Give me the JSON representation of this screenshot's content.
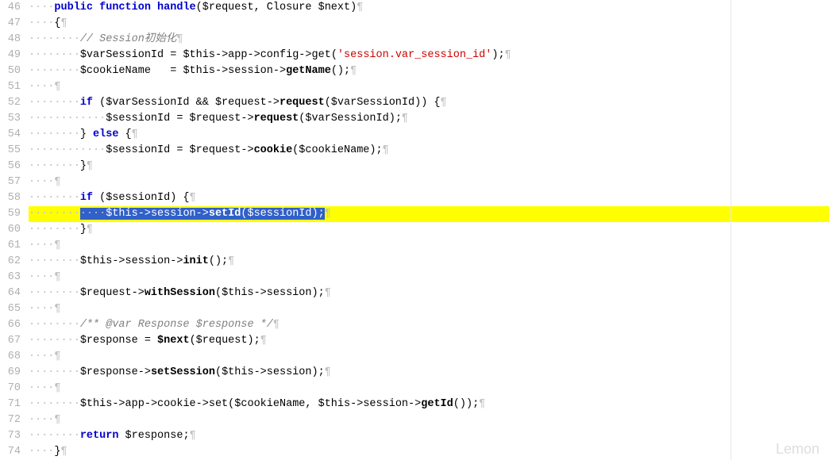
{
  "watermark": "Lemon",
  "lines": {
    "l46": "46",
    "l47": "47",
    "l48": "48",
    "l49": "49",
    "l50": "50",
    "l51": "51",
    "l52": "52",
    "l53": "53",
    "l54": "54",
    "l55": "55",
    "l56": "56",
    "l57": "57",
    "l58": "58",
    "l59": "59",
    "l60": "60",
    "l61": "61",
    "l62": "62",
    "l63": "63",
    "l64": "64",
    "l65": "65",
    "l66": "66",
    "l67": "67",
    "l68": "68",
    "l69": "69",
    "l70": "70",
    "l71": "71",
    "l72": "72",
    "l73": "73",
    "l74": "74"
  },
  "code": {
    "c46_ws": "····",
    "c46_kw1": "public",
    "c46_sp1": " ",
    "c46_kw2": "function",
    "c46_sp2": " ",
    "c46_fn": "handle",
    "c46_paren": "(",
    "c46_v1": "$request",
    "c46_comma": ", ",
    "c46_v2": "Closure",
    "c46_sp3": " ",
    "c46_v3": "$next",
    "c46_close": ")",
    "c47_ws": "····",
    "c47_brace": "{",
    "c48_ws": "········",
    "c48_cmt": "// Session初始化",
    "c49_ws": "········",
    "c49_v1": "$varSessionId",
    "c49_sp1": " = ",
    "c49_v2": "$this",
    "c49_arr1": "->",
    "c49_p1": "app",
    "c49_arr2": "->",
    "c49_p2": "config",
    "c49_arr3": "->",
    "c49_m1": "get",
    "c49_open": "(",
    "c49_str": "'session.var_session_id'",
    "c49_close": ");",
    "c50_ws": "········",
    "c50_v1": "$cookieName",
    "c50_sp1": "   = ",
    "c50_v2": "$this",
    "c50_arr1": "->",
    "c50_p1": "session",
    "c50_arr2": "->",
    "c50_m1": "getName",
    "c50_close": "();",
    "c52_ws": "········",
    "c52_if": "if",
    "c52_sp": " (",
    "c52_v1": "$varSessionId",
    "c52_and": " && ",
    "c52_v2": "$request",
    "c52_arr": "->",
    "c52_m": "request",
    "c52_open": "(",
    "c52_v3": "$varSessionId",
    "c52_close": ")) {",
    "c53_ws": "············",
    "c53_v1": "$sessionId",
    "c53_eq": " = ",
    "c53_v2": "$request",
    "c53_arr": "->",
    "c53_m": "request",
    "c53_open": "(",
    "c53_v3": "$varSessionId",
    "c53_close": ");",
    "c54_ws": "········",
    "c54_brace": "} ",
    "c54_else": "else",
    "c54_open": " {",
    "c55_ws": "············",
    "c55_v1": "$sessionId",
    "c55_eq": " = ",
    "c55_v2": "$request",
    "c55_arr": "->",
    "c55_m": "cookie",
    "c55_open": "(",
    "c55_v3": "$cookieName",
    "c55_close": ");",
    "c56_ws": "········",
    "c56_brace": "}",
    "c58_ws": "········",
    "c58_if": "if",
    "c58_sp": " (",
    "c58_v1": "$sessionId",
    "c58_close": ") {",
    "c59_ws_pre": "········",
    "c59_ws_sel": "····",
    "c59_v1": "$this",
    "c59_arr1": "->",
    "c59_p1": "session",
    "c59_arr2": "->",
    "c59_m": "setId",
    "c59_open": "(",
    "c59_v2": "$sessionId",
    "c59_close": ");",
    "c60_ws": "········",
    "c60_brace": "}",
    "c62_ws": "········",
    "c62_v1": "$this",
    "c62_arr1": "->",
    "c62_p1": "session",
    "c62_arr2": "->",
    "c62_m": "init",
    "c62_close": "();",
    "c64_ws": "········",
    "c64_v1": "$request",
    "c64_arr": "->",
    "c64_m": "withSession",
    "c64_open": "(",
    "c64_v2": "$this",
    "c64_arr2": "->",
    "c64_p2": "session",
    "c64_close": ");",
    "c66_ws": "········",
    "c66_cmt": "/** @var Response $response */",
    "c67_ws": "········",
    "c67_v1": "$response",
    "c67_eq": " = ",
    "c67_v2": "$next",
    "c67_open": "(",
    "c67_v3": "$request",
    "c67_close": ");",
    "c69_ws": "········",
    "c69_v1": "$response",
    "c69_arr": "->",
    "c69_m": "setSession",
    "c69_open": "(",
    "c69_v2": "$this",
    "c69_arr2": "->",
    "c69_p2": "session",
    "c69_close": ");",
    "c71_ws": "········",
    "c71_v1": "$this",
    "c71_arr1": "->",
    "c71_p1": "app",
    "c71_arr2": "->",
    "c71_p2": "cookie",
    "c71_arr3": "->",
    "c71_m": "set",
    "c71_open": "(",
    "c71_v2": "$cookieName",
    "c71_comma": ", ",
    "c71_v3": "$this",
    "c71_arr4": "->",
    "c71_p3": "session",
    "c71_arr5": "->",
    "c71_m2": "getId",
    "c71_close": "());",
    "c73_ws": "········",
    "c73_ret": "return",
    "c73_sp": " ",
    "c73_v1": "$response",
    "c73_semi": ";",
    "c74_ws": "····",
    "c74_brace": "}",
    "pilcrow": "¶",
    "blank_ws4": "····",
    "blank_ws8": "········"
  }
}
